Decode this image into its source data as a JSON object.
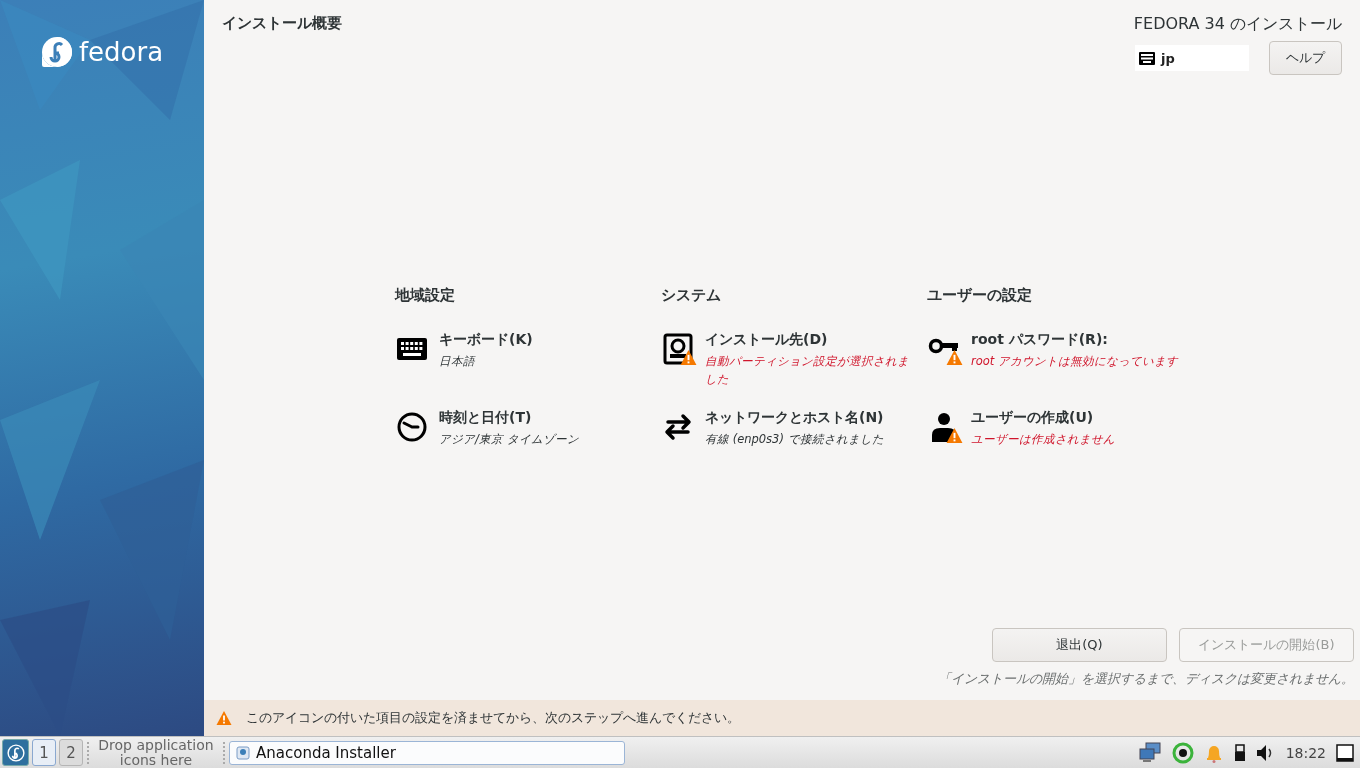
{
  "sidebar": {
    "logo_text": "fedora"
  },
  "header": {
    "title": "インストール概要",
    "product": "FEDORA 34 のインストール",
    "keyboard_layout": "jp",
    "help_button": "ヘルプ"
  },
  "categories": [
    {
      "title": "地域設定",
      "spokes": [
        {
          "kind": "keyboard",
          "title": "キーボード(K)",
          "status": "日本語",
          "warning": false
        },
        {
          "kind": "clock",
          "title": "時刻と日付(T)",
          "status": "アジア/東京 タイムゾーン",
          "warning": false
        }
      ]
    },
    {
      "title": "システム",
      "spokes": [
        {
          "kind": "disk",
          "title": "インストール先(D)",
          "status": "自動パーティション設定が選択されました",
          "warning": true
        },
        {
          "kind": "network",
          "title": "ネットワークとホスト名(N)",
          "status": "有線 (enp0s3) で接続されました",
          "warning": false
        }
      ]
    },
    {
      "title": "ユーザーの設定",
      "spokes": [
        {
          "kind": "key",
          "title": "root パスワード(R):",
          "status": "root アカウントは無効になっています",
          "warning": true
        },
        {
          "kind": "user",
          "title": "ユーザーの作成(U)",
          "status": "ユーザーは作成されません",
          "warning": true
        }
      ]
    }
  ],
  "buttons": [
    {
      "label": "退出(Q)",
      "disabled": false
    },
    {
      "label": "インストールの開始(B)",
      "disabled": true
    }
  ],
  "note": "「インストールの開始」を選択するまで、ディスクは変更されません。",
  "warning_bar": "このアイコンの付いた項目の設定を済ませてから、次のステップへ進んでください。",
  "taskbar": {
    "workspaces": [
      {
        "label": "1",
        "selected": true
      },
      {
        "label": "2",
        "selected": false
      }
    ],
    "drop_hint": "Drop application icons here",
    "task": "Anaconda Installer",
    "clock": "18:22"
  }
}
